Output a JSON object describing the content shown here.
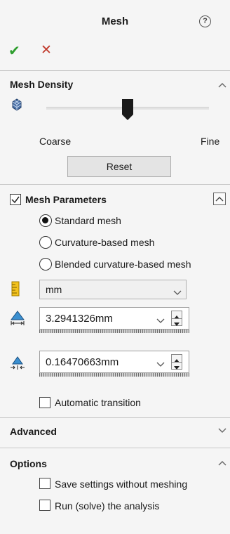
{
  "header": {
    "title": "Mesh",
    "help_icon": "help-icon",
    "ok_icon": "checkmark-icon",
    "cancel_icon": "x-icon"
  },
  "mesh_density": {
    "title": "Mesh Density",
    "coarse_label": "Coarse",
    "fine_label": "Fine",
    "slider_level": 0.5,
    "reset_label": "Reset"
  },
  "mesh_parameters": {
    "title": "Mesh Parameters",
    "checked": true,
    "options": [
      {
        "label": "Standard mesh",
        "selected": true
      },
      {
        "label": "Curvature-based mesh",
        "selected": false
      },
      {
        "label": "Blended curvature-based mesh",
        "selected": false
      }
    ],
    "unit": "mm",
    "global_size": "3.2941326mm",
    "tolerance": "0.16470663mm",
    "automatic_transition_label": "Automatic transition",
    "automatic_transition_checked": false
  },
  "advanced": {
    "title": "Advanced"
  },
  "options": {
    "title": "Options",
    "save_settings_label": "Save settings without meshing",
    "run_analysis_label": "Run (solve) the analysis"
  },
  "colors": {
    "ok": "#2e9e2e",
    "cancel": "#c0392b",
    "background": "#f5f5f5",
    "ruler_icon": "#e8b400",
    "mesh_icon": "#4a6fa5"
  }
}
